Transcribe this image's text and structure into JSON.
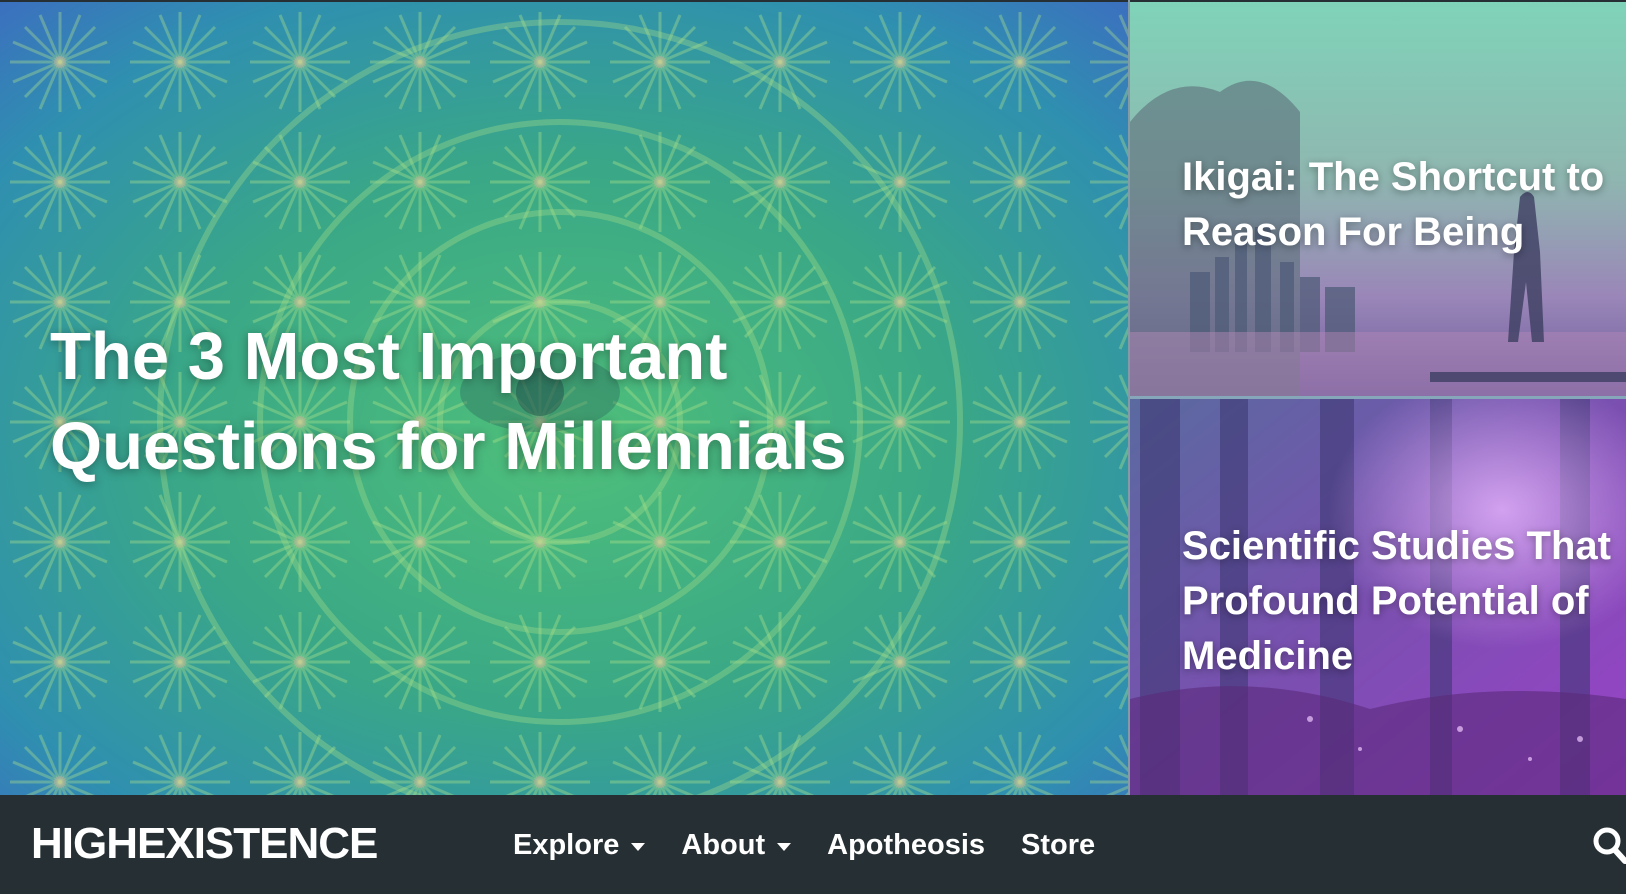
{
  "features": {
    "main": {
      "title": "The 3 Most Important Questions for Millennials"
    },
    "side": [
      {
        "title": "Ikigai: The Shortcut to\nReason For Being"
      },
      {
        "title": "Scientific Studies That\nProfound Potential of\nMedicine"
      }
    ]
  },
  "nav": {
    "logo": "HIGHEXISTENCE",
    "items": [
      {
        "label": "Explore",
        "has_dropdown": true
      },
      {
        "label": "About",
        "has_dropdown": true
      },
      {
        "label": "Apotheosis",
        "has_dropdown": false
      },
      {
        "label": "Store",
        "has_dropdown": false
      }
    ],
    "search_icon": "search-icon"
  },
  "colors": {
    "navbar_bg": "#263034",
    "text": "#ffffff",
    "main_tint": "#3fae8f",
    "side_top_tint": "#6bbfb0",
    "side_bottom_tint": "#7a3fb8"
  }
}
